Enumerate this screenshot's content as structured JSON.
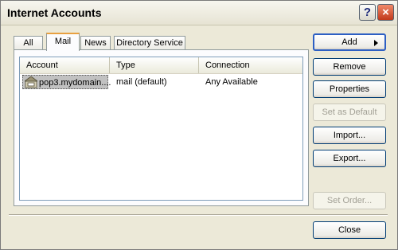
{
  "window": {
    "title": "Internet Accounts",
    "help_label": "?",
    "close_label": "×"
  },
  "tabs": [
    {
      "label": "All",
      "active": false
    },
    {
      "label": "Mail",
      "active": true
    },
    {
      "label": "News",
      "active": false
    },
    {
      "label": "Directory Service",
      "active": false
    }
  ],
  "list": {
    "columns": [
      "Account",
      "Type",
      "Connection"
    ],
    "rows": [
      {
        "icon": "mail-server-icon",
        "account": "pop3.mydomain....",
        "type": "mail (default)",
        "connection": "Any Available",
        "selected": true
      }
    ]
  },
  "buttons": {
    "add": "Add",
    "remove": "Remove",
    "properties": "Properties",
    "set_default": "Set as Default",
    "import": "Import...",
    "export": "Export...",
    "set_order": "Set Order...",
    "close": "Close"
  }
}
